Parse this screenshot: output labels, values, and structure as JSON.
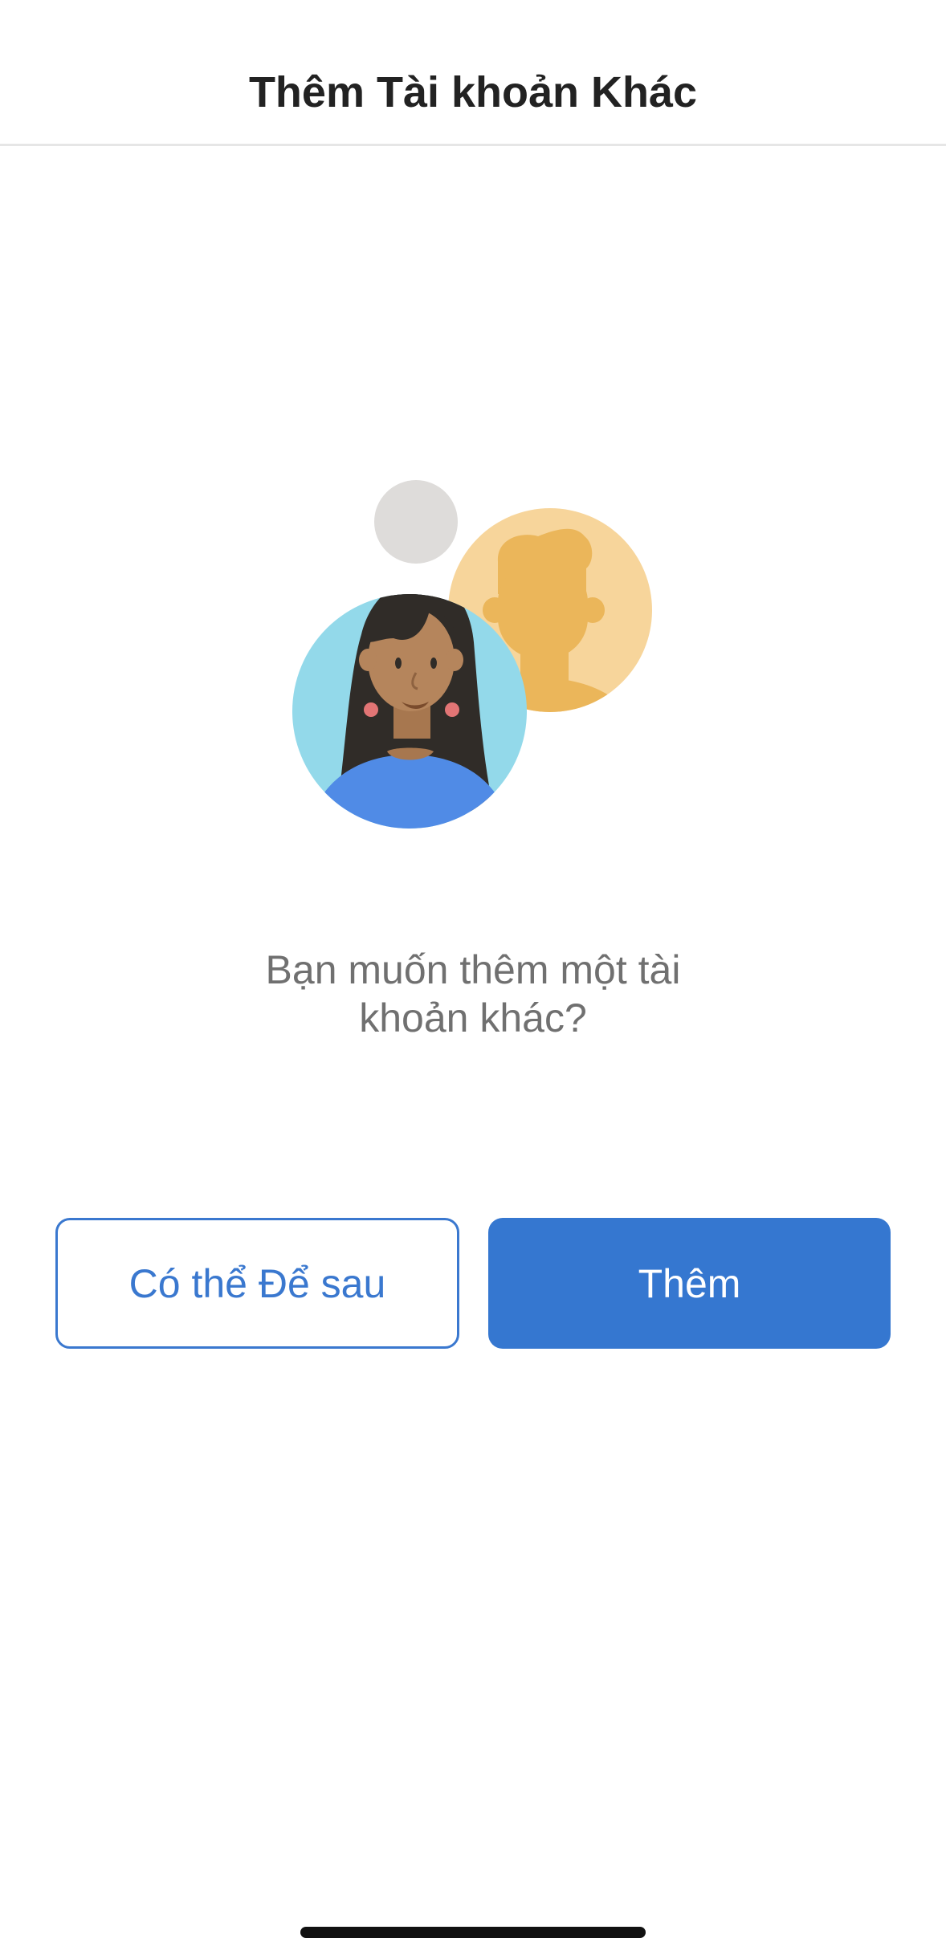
{
  "header": {
    "title": "Thêm Tài khoản Khác"
  },
  "illustration": {
    "icon": "add-account-illustration-icon",
    "colors": {
      "gray_dot": "#dedcda",
      "orange_circle": "#f7d59b",
      "orange_silhouette": "#ebb65a",
      "blue_circle": "#93d9ea",
      "hair": "#302c28",
      "skin": "#b5855c",
      "shirt": "#508be6",
      "earring": "#e27575"
    }
  },
  "prompt": {
    "line1": "Bạn muốn thêm một tài",
    "line2": "khoản khác?"
  },
  "buttons": {
    "later_label": "Có thể Để sau",
    "add_label": "Thêm"
  },
  "colors": {
    "accent": "#3577d0",
    "title_text": "#222222",
    "body_text": "#707070"
  }
}
